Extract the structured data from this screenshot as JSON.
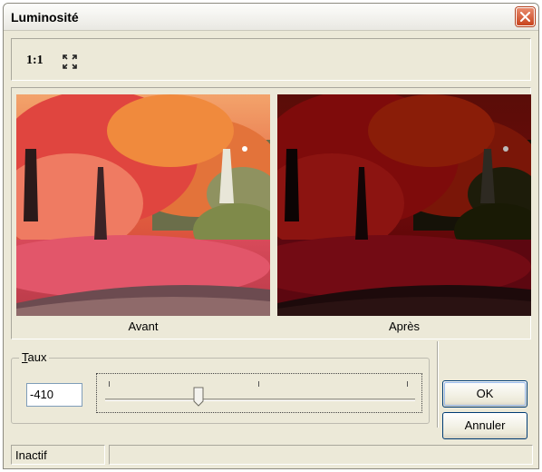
{
  "window": {
    "title": "Luminosité",
    "close_icon": "close-icon"
  },
  "toolbar": {
    "actual_size_label": "1:1",
    "fit_icon": "fit-to-window-icon"
  },
  "preview": {
    "before_caption": "Avant",
    "after_caption": "Après"
  },
  "rate": {
    "label_prefix": "T",
    "label_rest": "aux",
    "value": "-410",
    "slider_position": 0.3
  },
  "buttons": {
    "ok": "OK",
    "cancel": "Annuler"
  },
  "status": {
    "text": "Inactif",
    "secondary": ""
  },
  "colors": {
    "accent": "#003c74",
    "close_red": "#c8431e",
    "panel_bg": "#ece9d8"
  }
}
